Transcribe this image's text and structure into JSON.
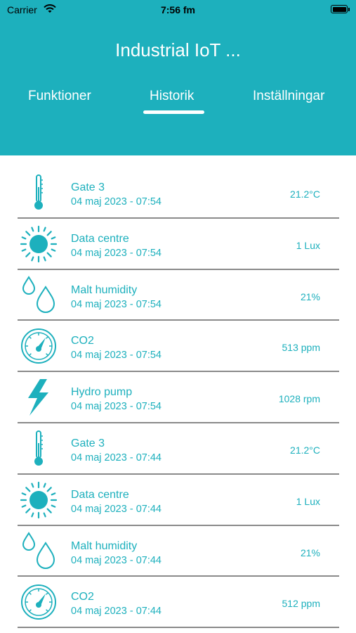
{
  "status_bar": {
    "carrier": "Carrier",
    "time": "7:56 fm"
  },
  "header": {
    "title": "Industrial IoT ...",
    "tabs": [
      {
        "label": "Funktioner",
        "active": false
      },
      {
        "label": "Historik",
        "active": true
      },
      {
        "label": "Inställningar",
        "active": false
      }
    ]
  },
  "colors": {
    "accent": "#1db0bd",
    "divider": "#8a8a8a"
  },
  "history": [
    {
      "icon": "thermometer-icon",
      "name": "Gate 3",
      "date": "04 maj 2023 - 07:54",
      "value": "21.2°C"
    },
    {
      "icon": "sun-icon",
      "name": "Data centre",
      "date": "04 maj 2023 - 07:54",
      "value": "1 Lux"
    },
    {
      "icon": "droplets-icon",
      "name": "Malt humidity",
      "date": "04 maj 2023 - 07:54",
      "value": "21%"
    },
    {
      "icon": "gauge-icon",
      "name": "CO2",
      "date": "04 maj 2023 - 07:54",
      "value": "513 ppm"
    },
    {
      "icon": "lightning-icon",
      "name": "Hydro pump",
      "date": "04 maj 2023 - 07:54",
      "value": "1028 rpm"
    },
    {
      "icon": "thermometer-icon",
      "name": "Gate 3",
      "date": "04 maj 2023 - 07:44",
      "value": "21.2°C"
    },
    {
      "icon": "sun-icon",
      "name": "Data centre",
      "date": "04 maj 2023 - 07:44",
      "value": "1 Lux"
    },
    {
      "icon": "droplets-icon",
      "name": "Malt humidity",
      "date": "04 maj 2023 - 07:44",
      "value": "21%"
    },
    {
      "icon": "gauge-icon",
      "name": "CO2",
      "date": "04 maj 2023 - 07:44",
      "value": "512 ppm"
    }
  ]
}
